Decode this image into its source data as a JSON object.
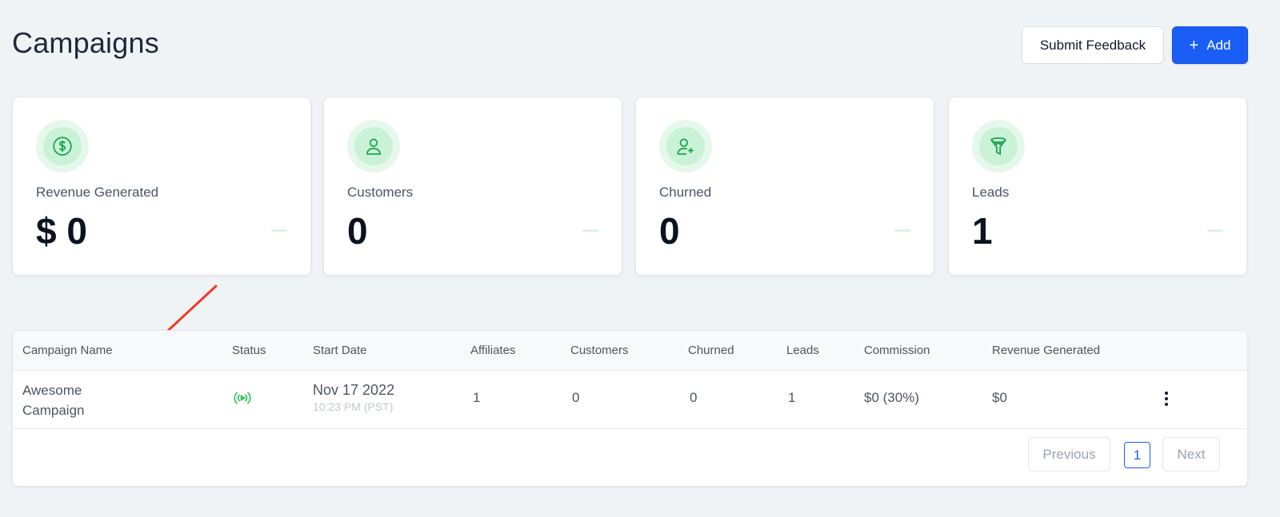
{
  "page": {
    "title": "Campaigns"
  },
  "header": {
    "feedback_label": "Submit Feedback",
    "add_label": "Add"
  },
  "stats": [
    {
      "icon": "dollar-circle-icon",
      "label": "Revenue Generated",
      "value": "$ 0"
    },
    {
      "icon": "user-icon",
      "label": "Customers",
      "value": "0"
    },
    {
      "icon": "user-plus-icon",
      "label": "Churned",
      "value": "0"
    },
    {
      "icon": "funnel-icon",
      "label": "Leads",
      "value": "1"
    }
  ],
  "table": {
    "columns": [
      "Campaign Name",
      "Status",
      "Start Date",
      "Affiliates",
      "Customers",
      "Churned",
      "Leads",
      "Commission",
      "Revenue Generated"
    ],
    "rows": [
      {
        "name": "Awesome Campaign",
        "status_icon": "broadcast-active-icon",
        "start_date": "Nov 17 2022",
        "start_time": "10:23 PM (PST)",
        "affiliates": "1",
        "customers": "0",
        "churned": "0",
        "leads": "1",
        "commission": "$0 (30%)",
        "revenue": "$0"
      }
    ]
  },
  "pagination": {
    "previous_label": "Previous",
    "current_page": "1",
    "next_label": "Next"
  },
  "colors": {
    "accent": "#1a5df5",
    "icon_green": "#16a34a",
    "annotation_arrow": "#f03a24"
  }
}
